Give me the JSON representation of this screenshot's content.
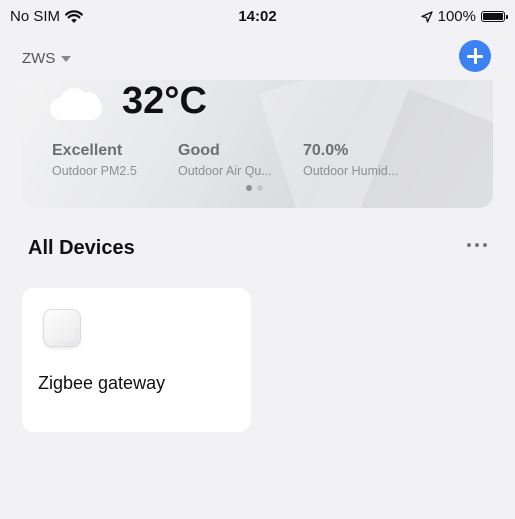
{
  "status_bar": {
    "carrier": "No SIM",
    "time": "14:02",
    "battery": "100%"
  },
  "header": {
    "home_name": "ZWS"
  },
  "weather": {
    "temperature": "32°C",
    "metrics": [
      {
        "value": "Excellent",
        "label": "Outdoor PM2.5"
      },
      {
        "value": "Good",
        "label": "Outdoor Air Qu..."
      },
      {
        "value": "70.0%",
        "label": "Outdoor Humid..."
      }
    ]
  },
  "devices_section": {
    "title": "All Devices"
  },
  "devices": [
    {
      "name": "Zigbee gateway"
    }
  ],
  "colors": {
    "accent": "#3d82f2",
    "background": "#f2f2f4"
  }
}
